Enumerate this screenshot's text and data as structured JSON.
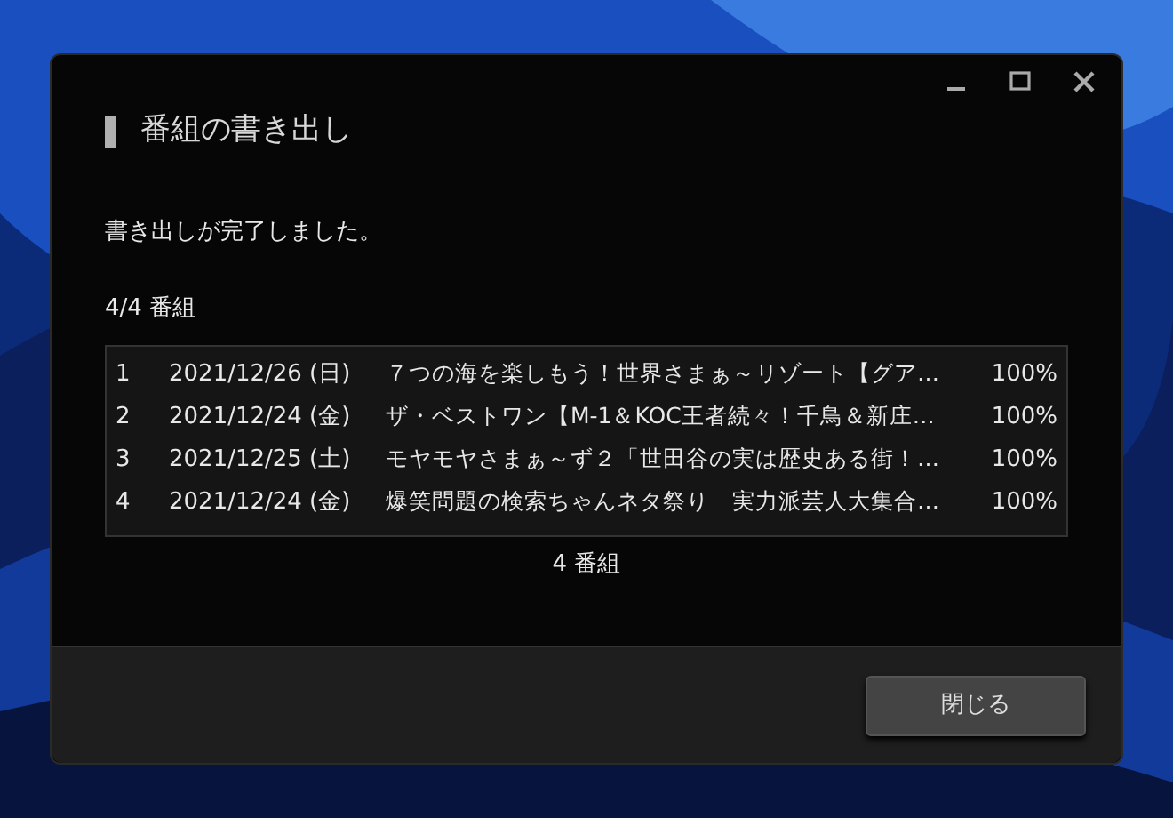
{
  "window": {
    "title": "番組の書き出し"
  },
  "message": "書き出しが完了しました。",
  "progress_count": "4/4 番組",
  "table": {
    "rows": [
      {
        "index": "1",
        "date": "2021/12/26 (日)",
        "title": "７つの海を楽しもう！世界さまぁ～リゾート【グア…",
        "percent": "100%"
      },
      {
        "index": "2",
        "date": "2021/12/24 (金)",
        "title": "ザ・ベストワン【M-1＆KOC王者続々！千鳥＆新庄…",
        "percent": "100%"
      },
      {
        "index": "3",
        "date": "2021/12/25 (土)",
        "title": "モヤモヤさまぁ～ず２「世田谷の実は歴史ある街！…",
        "percent": "100%"
      },
      {
        "index": "4",
        "date": "2021/12/24 (金)",
        "title": "爆笑問題の検索ちゃんネタ祭り　実力派芸人大集合…",
        "percent": "100%"
      }
    ]
  },
  "total": "4 番組",
  "buttons": [
    "閉じる"
  ]
}
